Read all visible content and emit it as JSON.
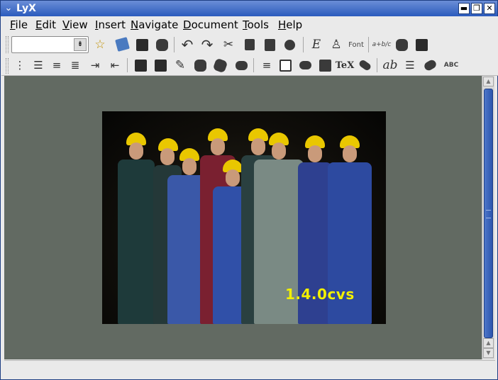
{
  "window": {
    "title": "LyX",
    "menu_glyph": "⌄",
    "minimize_glyph": "▬",
    "maximize_glyph": "❐",
    "close_glyph": "✕"
  },
  "menubar": {
    "items": [
      {
        "label": "File",
        "mnemonic": "F",
        "rest": "ile"
      },
      {
        "label": "Edit",
        "mnemonic": "E",
        "rest": "dit"
      },
      {
        "label": "View",
        "mnemonic": "V",
        "rest": "iew"
      },
      {
        "label": "Insert",
        "mnemonic": "I",
        "rest": "nsert"
      },
      {
        "label": "Navigate",
        "mnemonic": "N",
        "rest": "avigate"
      },
      {
        "label": "Document",
        "mnemonic": "D",
        "rest": "ocument"
      },
      {
        "label": "Tools",
        "mnemonic": "T",
        "rest": "ools"
      },
      {
        "label": "Help",
        "mnemonic": "H",
        "rest": "elp"
      }
    ]
  },
  "toolbar": {
    "layout_combo_value": "",
    "combo_arrow_glyph": "⇟",
    "font_label": "Font",
    "math_frac_label": "a+b/c",
    "tex_label": "TeX",
    "ab_label": "ab",
    "spell_label": "ABC",
    "undo_glyph": "↶",
    "redo_glyph": "↷",
    "cut_glyph": "✂",
    "emph_glyph": "E",
    "new_glyph": "☆",
    "numbered_list_glyph": "⋮",
    "bullet_list_glyph": "☰",
    "depth_inc_glyph": "⇥",
    "depth_dec_glyph": "⇤"
  },
  "document": {
    "splash_version": "1.4.0cvs"
  },
  "scrollbar": {
    "up_glyph": "▲",
    "down_glyph": "▼"
  },
  "status": {
    "text": ""
  }
}
